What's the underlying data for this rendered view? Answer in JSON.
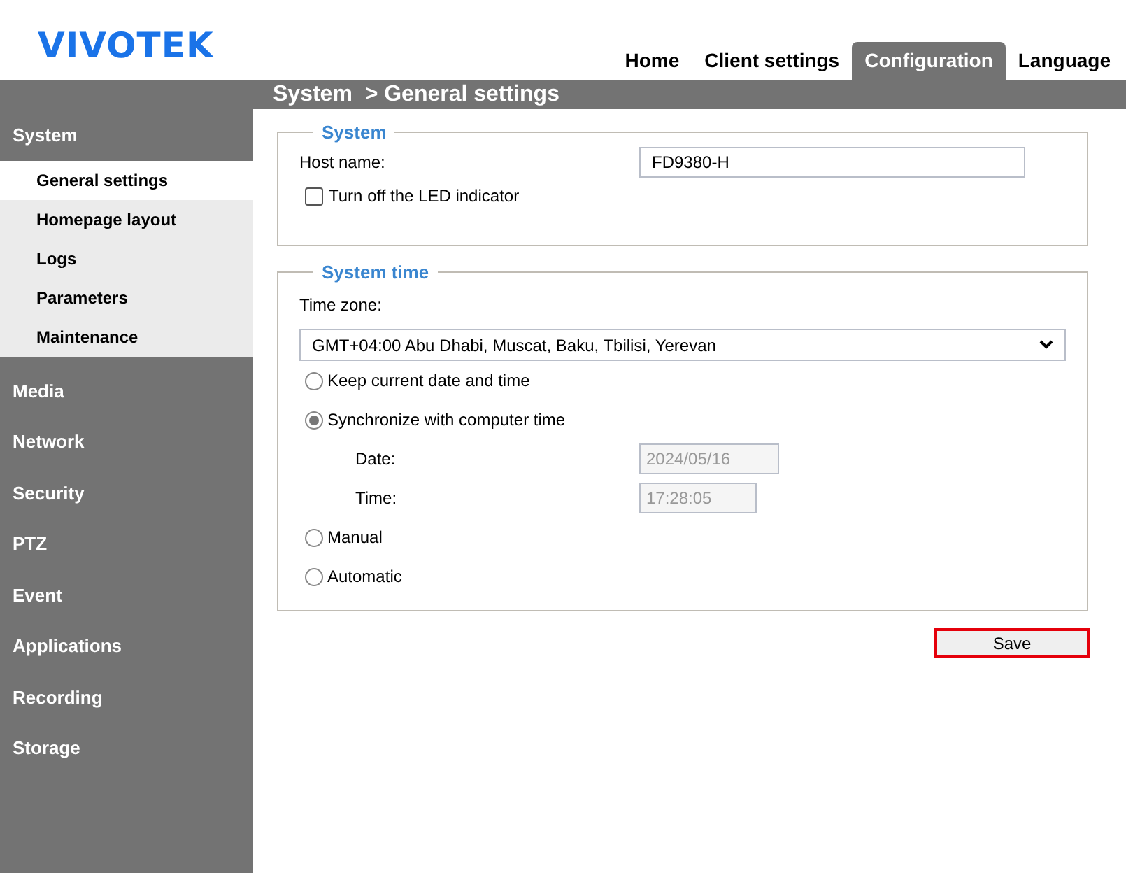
{
  "logo": "VIVOTEK",
  "top_nav": [
    {
      "label": "Home",
      "selected": false
    },
    {
      "label": "Client settings",
      "selected": false
    },
    {
      "label": "Configuration",
      "selected": true
    },
    {
      "label": "Language",
      "selected": false
    }
  ],
  "breadcrumb": "System  > General settings",
  "sidebar": [
    {
      "label": "System",
      "children": [
        {
          "label": "General settings",
          "selected": true
        },
        {
          "label": "Homepage layout",
          "selected": false
        },
        {
          "label": "Logs",
          "selected": false
        },
        {
          "label": "Parameters",
          "selected": false
        },
        {
          "label": "Maintenance",
          "selected": false
        }
      ]
    },
    {
      "label": "Media"
    },
    {
      "label": "Network"
    },
    {
      "label": "Security"
    },
    {
      "label": "PTZ"
    },
    {
      "label": "Event"
    },
    {
      "label": "Applications"
    },
    {
      "label": "Recording"
    },
    {
      "label": "Storage"
    }
  ],
  "system_section": {
    "legend": "System",
    "host_name_label": "Host name:",
    "host_name": "FD9380-H",
    "led_label": "Turn off the LED indicator",
    "led_checked": false
  },
  "time_section": {
    "legend": "System time",
    "time_zone_label": "Time zone:",
    "time_zone": "GMT+04:00 Abu Dhabi, Muscat, Baku, Tbilisi, Yerevan",
    "options": [
      {
        "label": "Keep current date and time",
        "selected": false
      },
      {
        "label": "Synchronize with computer time",
        "selected": true,
        "fields": [
          {
            "label": "Date:",
            "value": "2024/05/16"
          },
          {
            "label": "Time:",
            "value": "17:28:05"
          }
        ]
      },
      {
        "label": "Manual",
        "selected": false
      },
      {
        "label": "Automatic",
        "selected": false
      }
    ]
  },
  "save_button": {
    "label": "Save",
    "highlighted": true
  }
}
